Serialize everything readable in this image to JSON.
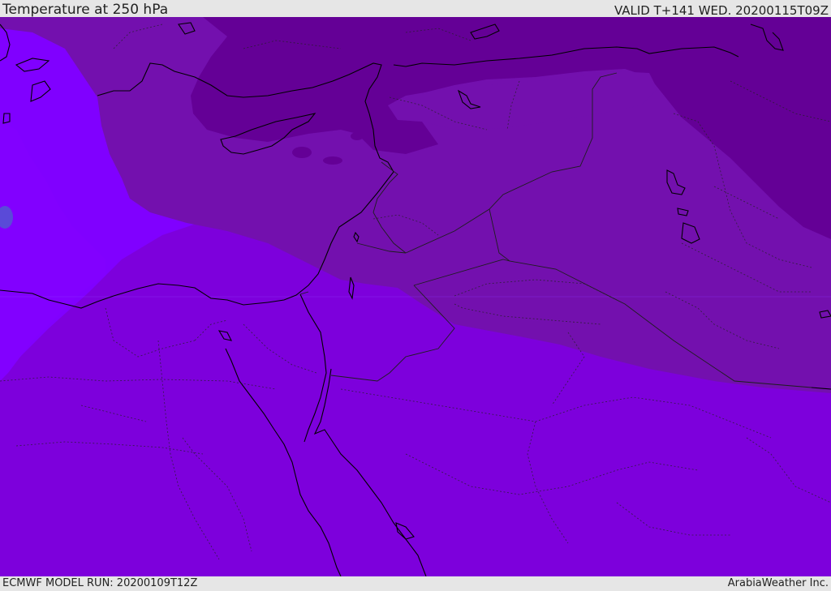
{
  "header": {
    "title": "Temperature at 250 hPa",
    "valid": "VALID T+141 WED. 20200115T09Z"
  },
  "map": {
    "field": "temperature",
    "level": "250 hPa",
    "colors": {
      "band_coldest": "#640096",
      "band_cold": "#7310ae",
      "band_mid": "#7d00dc",
      "band_warm": "#8000ff",
      "band_blue_spot": "#5a4ad8",
      "coastline": "#000000",
      "borders": "#1e1e1e"
    }
  },
  "footer": {
    "model_run": "ECMWF MODEL RUN: 20200109T12Z",
    "credit": "ArabiaWeather Inc."
  }
}
